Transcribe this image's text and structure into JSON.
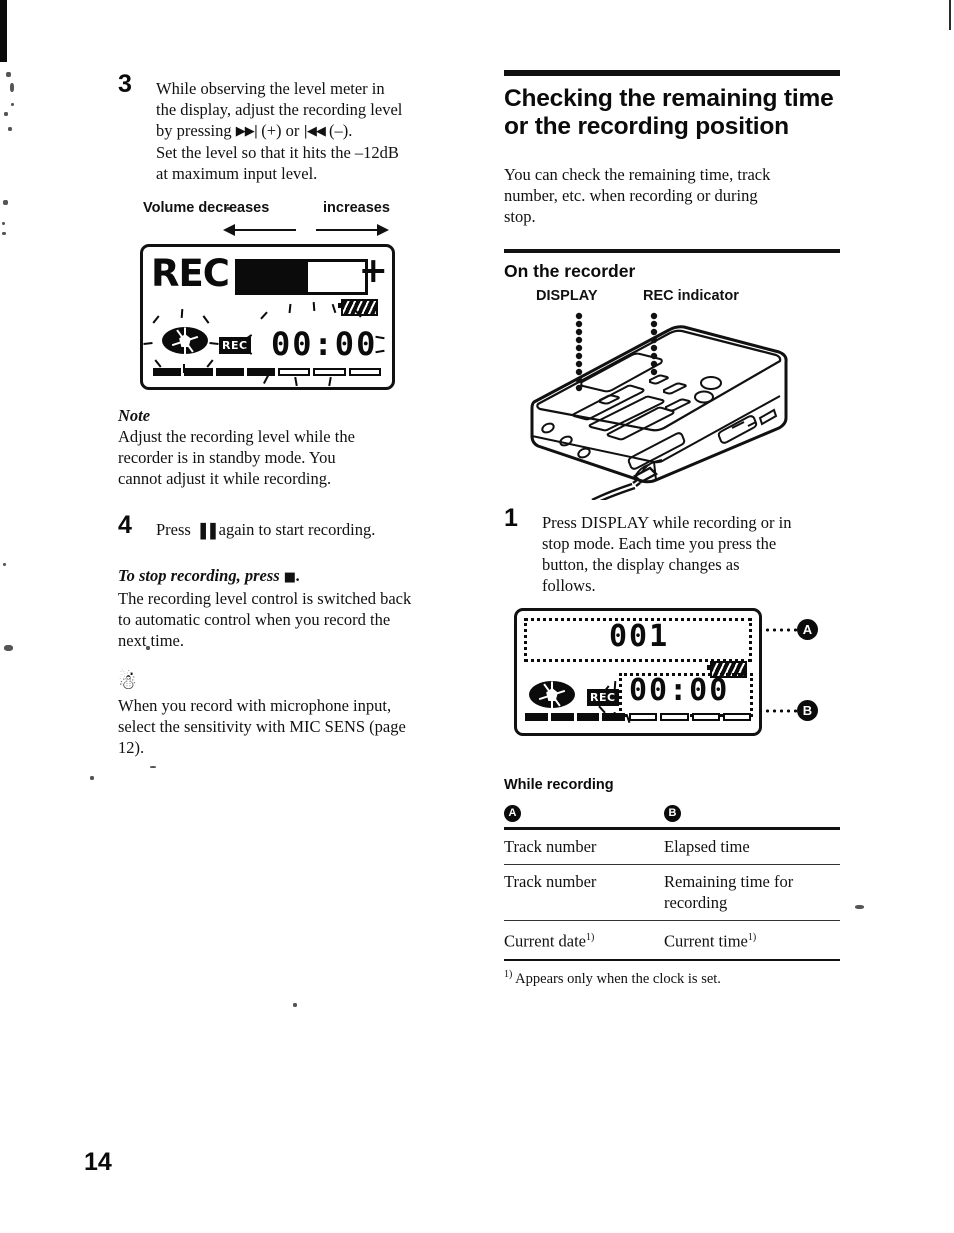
{
  "page": {
    "number": "14"
  },
  "left_column": {
    "step3": {
      "number": "3",
      "line1": "While observing the level meter in",
      "line2": "the display, adjust the recording level",
      "line3_pre": "by pressing ",
      "line3_ffwd_icon": "fast-forward-icon",
      "line3_mid": " (+) or ",
      "line3_rew_icon": "rewind-icon",
      "line3_post": " (–).",
      "line4": "Set the level so that it hits the –12dB",
      "line5": "at maximum input level."
    },
    "meter_caption": {
      "decrease_label": "Volume decreases",
      "increase_label": "increases"
    },
    "lcd_level": {
      "rec_word": "REC",
      "plus_sign": "+",
      "bar_fill_percent": 55,
      "battery_icon": "battery-icon",
      "disc_icon": "disc-icon",
      "rec_badge": "REC",
      "time_value": "00:00"
    },
    "note": {
      "title": "Note",
      "line1": "Adjust the recording level while the",
      "line2": "recorder is in standby mode. You",
      "line3": "cannot adjust it while recording."
    },
    "step4": {
      "number": "4",
      "pre": "Press ",
      "pause_icon": "pause-icon",
      "post": " again to start recording."
    },
    "stop_section": {
      "heading_pre": "To stop recording, press ",
      "stop_icon": "stop-icon",
      "heading_post": ".",
      "line1": "The recording level control is switched back",
      "line2": "to automatic control when you record the",
      "line3": "next time."
    },
    "tip": {
      "icon": "tip-bulb-icon",
      "line1": "When you record with microphone input,",
      "line2": "select the sensitivity with MIC SENS  (page",
      "line3": "12)."
    }
  },
  "right_column": {
    "heading": "Checking the remaining time or the recording position",
    "intro": {
      "line1": "You can check the remaining time, track",
      "line2": "number, etc. when recording or during",
      "line3": "stop."
    },
    "subheading": "On the recorder",
    "figure": {
      "display_label": "DISPLAY",
      "rec_indicator_label": "REC indicator",
      "device": "minidisc-recorder-illustration"
    },
    "step1": {
      "number": "1",
      "line1": "Press DISPLAY while recording or in",
      "line2": "stop mode. Each time you press the",
      "line3": "button, the display changes as",
      "line4": "follows."
    },
    "lcd_display": {
      "track_number": "001",
      "battery_icon": "battery-icon",
      "disc_icon": "disc-icon",
      "rec_badge": "REC",
      "time_value": "00:00",
      "callout_a": "A",
      "callout_b": "B"
    },
    "table": {
      "title": "While recording",
      "col_a_badge": "A",
      "col_b_badge": "B",
      "rows": [
        {
          "a": "Track number",
          "b": "Elapsed time"
        },
        {
          "a": "Track number",
          "b": "Remaining time for recording"
        },
        {
          "a": "Current date",
          "a_sup": "1)",
          "b": "Current time",
          "b_sup": "1)"
        }
      ],
      "footnote_sup": "1)",
      "footnote": " Appears only when the clock is set."
    }
  },
  "colors": {
    "ink": "#111111",
    "paper": "#ffffff"
  }
}
